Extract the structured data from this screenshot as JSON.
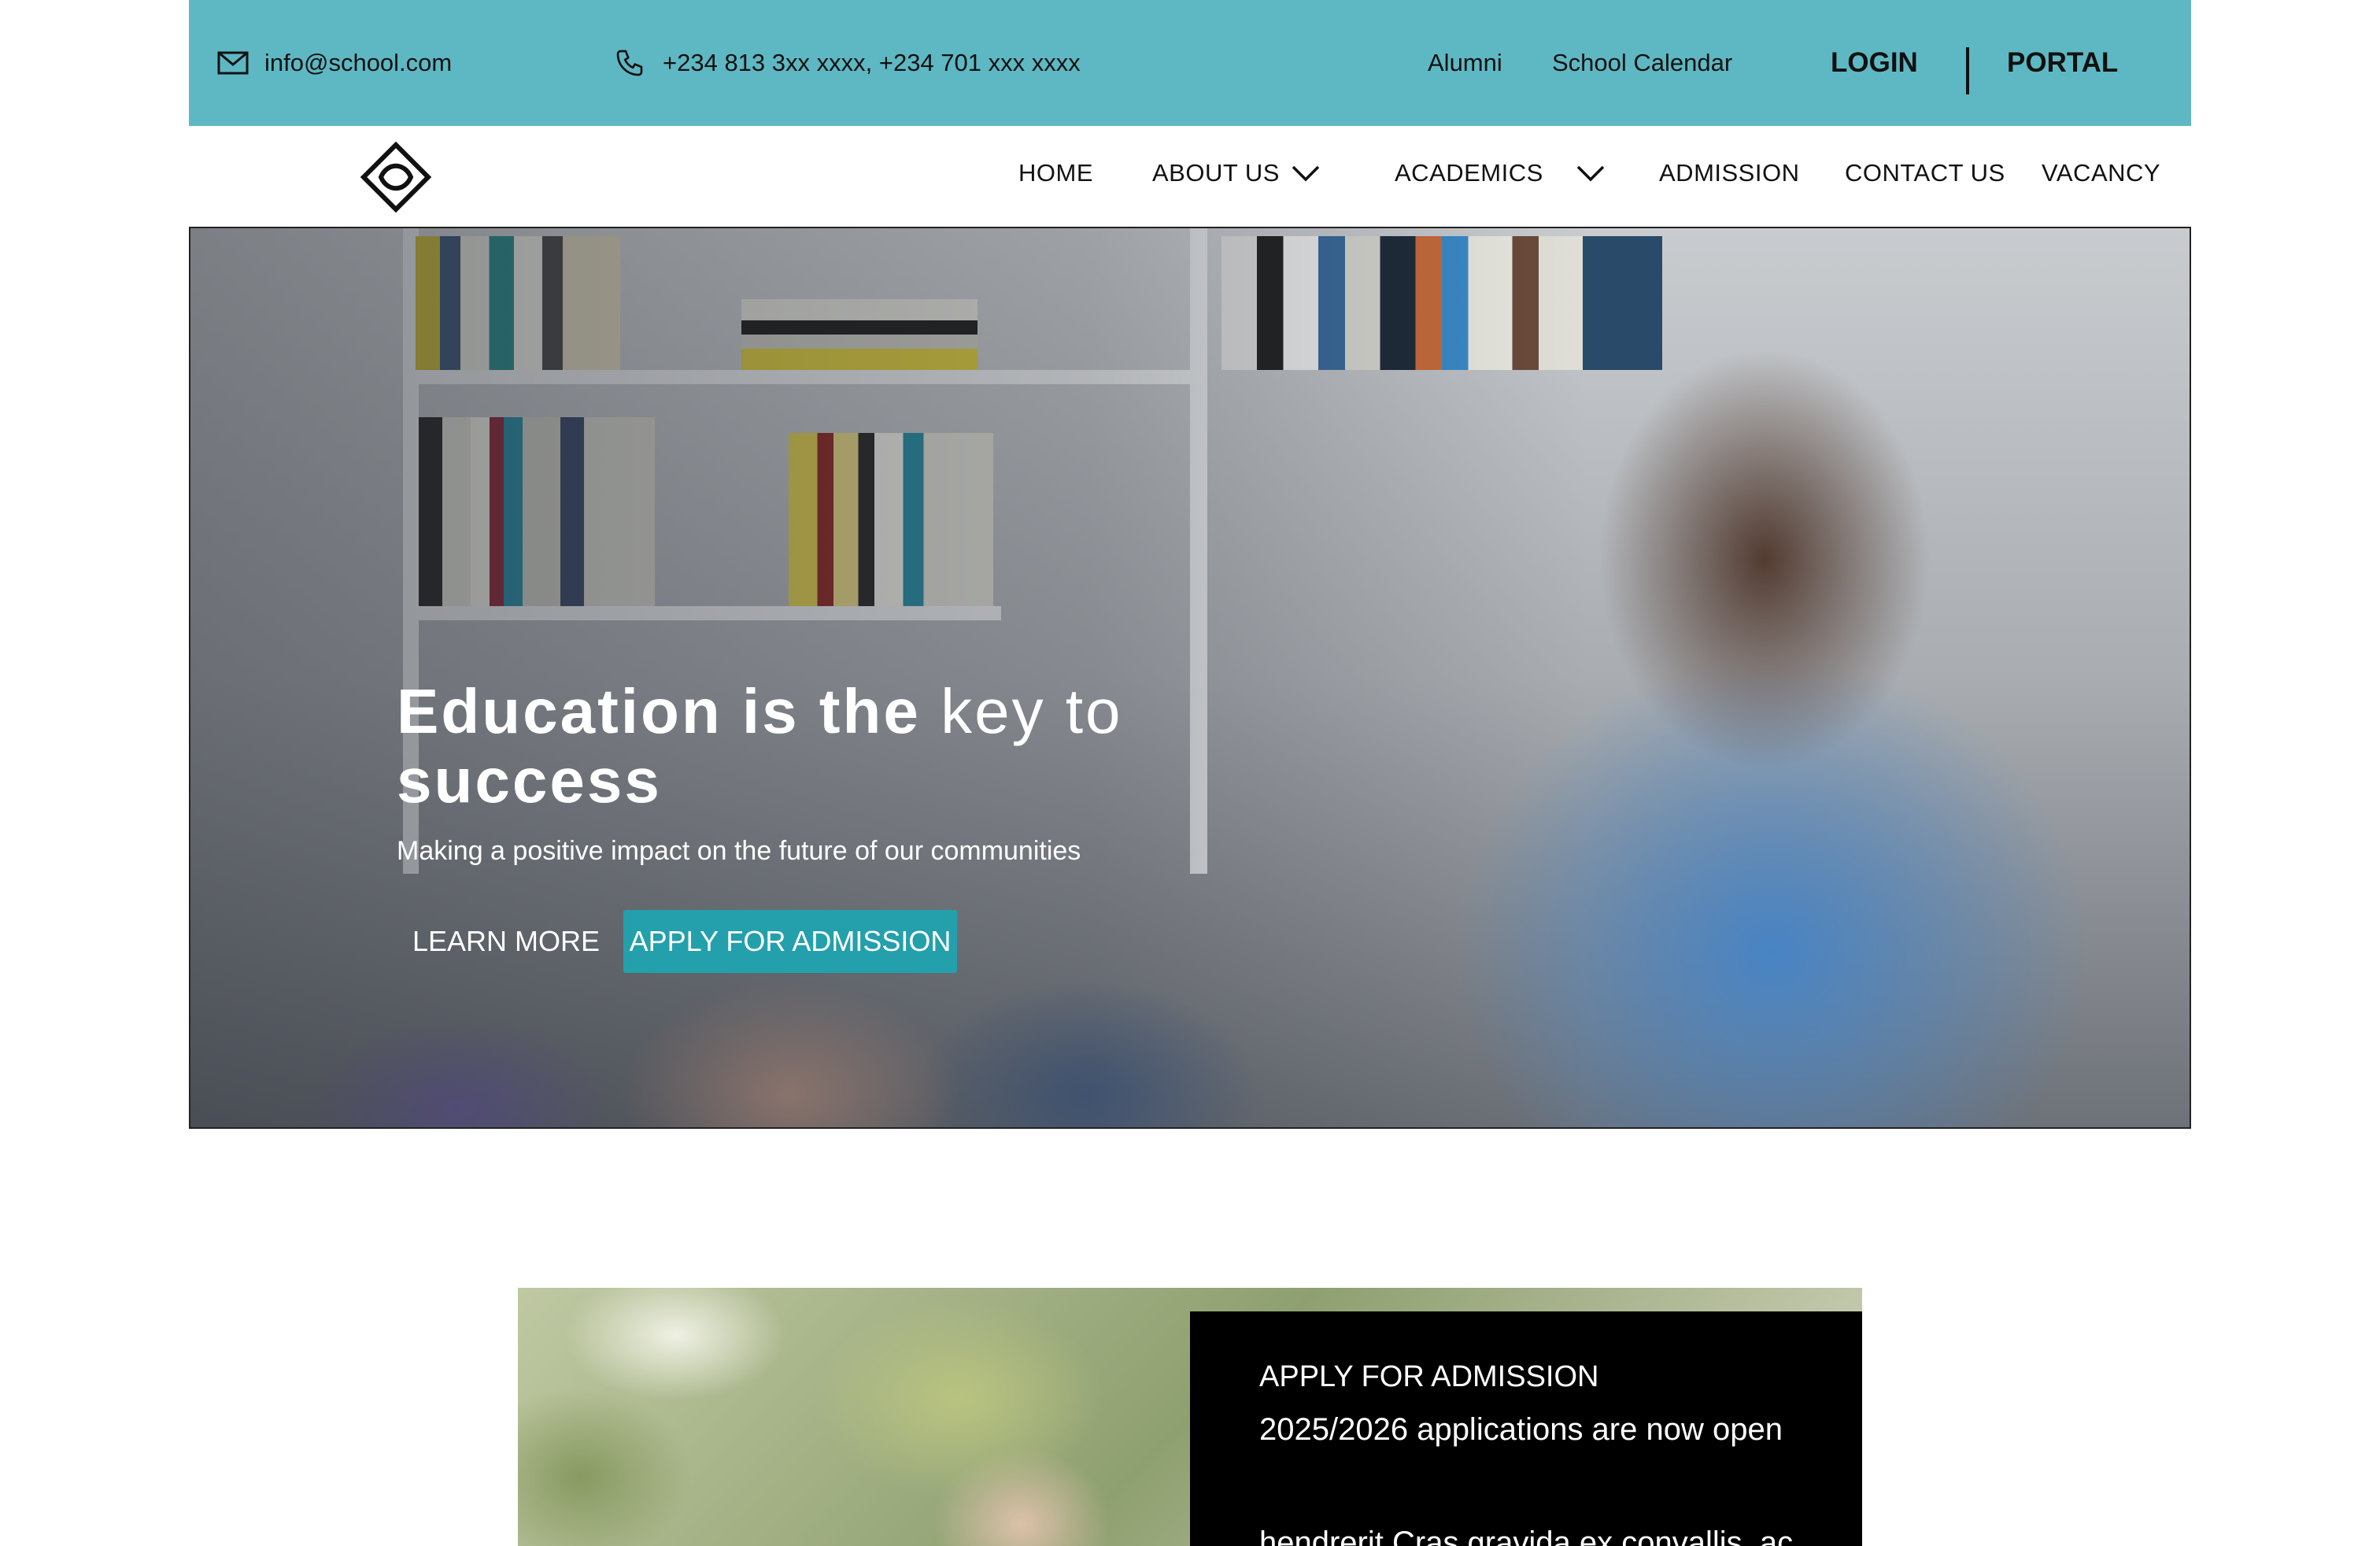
{
  "topbar": {
    "email": "info@school.com",
    "phone": "+234 813 3xx xxxx, +234 701 xxx xxxx",
    "alumni": "Alumni",
    "calendar": "School Calendar",
    "login": "LOGIN",
    "portal": "PORTAL",
    "bg_color": "#5eb8c3"
  },
  "nav": {
    "items": [
      {
        "label": "HOME"
      },
      {
        "label": "ABOUT US"
      },
      {
        "label": "ACADEMICS"
      },
      {
        "label": "ADMISSION"
      },
      {
        "label": "CONTACT US"
      },
      {
        "label": "VACANCY"
      }
    ]
  },
  "hero": {
    "title_bold": "Education is the",
    "title_light": "key to",
    "title_line2": "success",
    "subtitle": "Making a positive impact on the future of our communities",
    "learn_more": "LEARN MORE",
    "apply": "APPLY FOR ADMISSION",
    "accent_color": "#23a0ac"
  },
  "promo": {
    "title": "APPLY FOR ADMISSION",
    "line": "2025/2026 applications are now open",
    "body": "hendrerit Cras gravida ex convallis, ac"
  }
}
